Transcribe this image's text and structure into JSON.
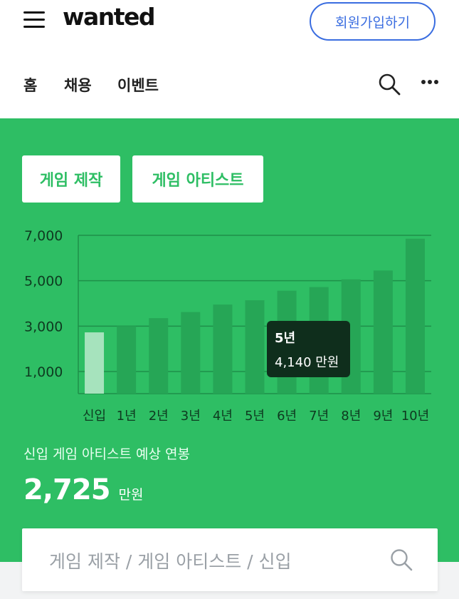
{
  "header": {
    "logo": "wanted",
    "signup_label": "회원가입하기"
  },
  "nav": {
    "items": [
      "홈",
      "채용",
      "이벤트"
    ]
  },
  "chips": [
    "게임 제작",
    "게임 아티스트"
  ],
  "chart_data": {
    "type": "bar",
    "categories": [
      "신입",
      "1년",
      "2년",
      "3년",
      "4년",
      "5년",
      "6년",
      "7년",
      "8년",
      "9년",
      "10년"
    ],
    "values": [
      2725,
      3000,
      3350,
      3620,
      3950,
      4140,
      4560,
      4720,
      5060,
      5450,
      6850
    ],
    "yticks": [
      1000,
      3000,
      5000,
      7000
    ],
    "ytick_labels": [
      "1,000",
      "3,000",
      "5,000",
      "7,000"
    ],
    "ylim": [
      0,
      7000
    ],
    "highlighted_index": 0,
    "colors": {
      "bar": "#26a656",
      "highlight": "#a6e3bd",
      "grid": "#1f8f49"
    }
  },
  "tooltip": {
    "title": "5년",
    "value": "4,140 만원"
  },
  "salary": {
    "label": "신입 게임 아티스트 예상 연봉",
    "value": "2,725",
    "unit": "만원"
  },
  "search": {
    "placeholder": "게임 제작 / 게임 아티스트 / 신입"
  },
  "colors": {
    "green": "#2ebe64",
    "accent_blue": "#3a6de0"
  }
}
